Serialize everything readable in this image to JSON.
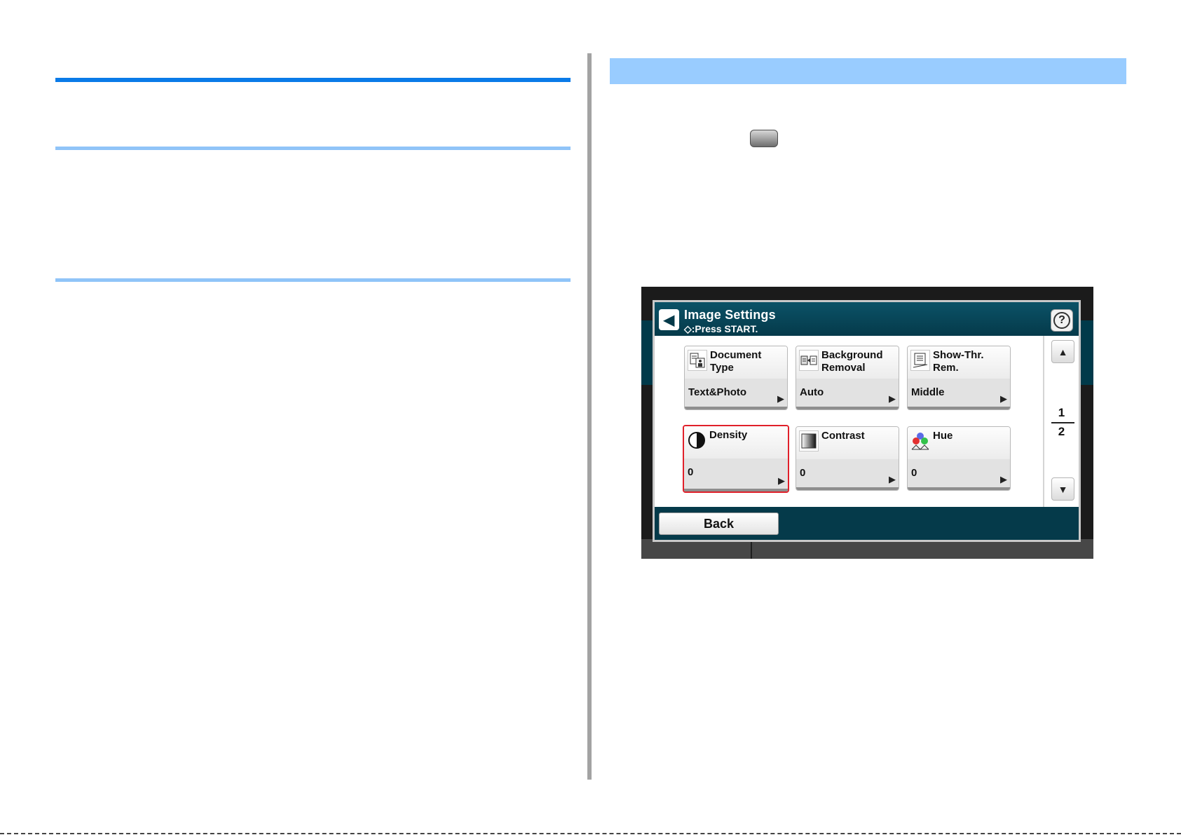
{
  "colors": {
    "primary_rule": "#0a7be8",
    "secondary_rule": "#90c4f8",
    "section_bar": "#99ccff",
    "panel_header": "#053a4a",
    "selection_border": "#e0202a"
  },
  "panel": {
    "title": "Image Settings",
    "subtitle": "◇:Press START.",
    "help_icon": "question-mark-icon",
    "back_icon": "back-arrow-icon",
    "tiles": [
      {
        "name": "Document Type",
        "value": "Text&Photo",
        "icon": "document-type-icon",
        "selected": false
      },
      {
        "name": "Background Removal",
        "value": "Auto",
        "icon": "background-removal-icon",
        "selected": false
      },
      {
        "name": "Show-Thr. Rem.",
        "value": "Middle",
        "icon": "show-through-removal-icon",
        "selected": false
      },
      {
        "name": "Density",
        "value": "0",
        "icon": "density-icon",
        "selected": true
      },
      {
        "name": "Contrast",
        "value": "0",
        "icon": "contrast-icon",
        "selected": false
      },
      {
        "name": "Hue",
        "value": "0",
        "icon": "hue-icon",
        "selected": false
      }
    ],
    "page_current": "1",
    "page_total": "2",
    "back_label": "Back"
  }
}
